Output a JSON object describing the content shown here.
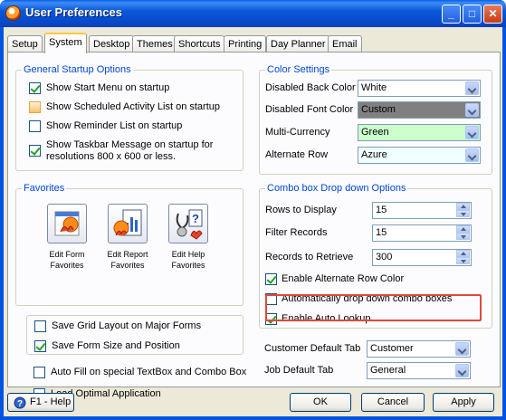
{
  "window": {
    "title": "User Preferences",
    "minimize": "_",
    "maximize": "□",
    "close": "✕"
  },
  "tabs": [
    "Setup",
    "System",
    "Desktop",
    "Themes",
    "Shortcuts",
    "Printing",
    "Day Planner",
    "Email"
  ],
  "active_tab": "System",
  "startup": {
    "title": "General Startup Options",
    "items": [
      {
        "label": "Show Start Menu on startup",
        "checked": true
      },
      {
        "label": "Show Scheduled Activity List on startup",
        "checked": false
      },
      {
        "label": "Show Reminder List on startup",
        "checked": false
      },
      {
        "label": "Show Taskbar Message on startup for",
        "label2": "resolutions 800 x 600 or less.",
        "checked": true
      }
    ]
  },
  "favorites": {
    "title": "Favorites",
    "buttons": [
      {
        "line1": "Edit Form",
        "line2": "Favorites",
        "icon": "form-favorites-icon"
      },
      {
        "line1": "Edit Report",
        "line2": "Favorites",
        "icon": "report-favorites-icon"
      },
      {
        "line1": "Edit Help",
        "line2": "Favorites",
        "icon": "help-favorites-icon"
      }
    ]
  },
  "misc": [
    {
      "label": "Save Grid Layout on Major Forms",
      "checked": false
    },
    {
      "label": "Save Form Size and Position",
      "checked": true
    },
    {
      "label": "Auto Fill on special TextBox and Combo Box",
      "checked": false
    },
    {
      "label": "Load Optimal Application",
      "checked": false
    }
  ],
  "colors": {
    "title": "Color Settings",
    "rows": [
      {
        "label": "Disabled Back Color",
        "value": "White",
        "bg": "#ffffff"
      },
      {
        "label": "Disabled Font Color",
        "value": "Custom",
        "bg": "#808080"
      },
      {
        "label": "Multi-Currency",
        "value": "Green",
        "bg": "#ccffcc"
      },
      {
        "label": "Alternate Row",
        "value": "Azure",
        "bg": "#f0ffff"
      }
    ]
  },
  "combo_opts": {
    "title": "Combo box Drop down Options",
    "rows_to_display_label": "Rows to Display",
    "rows_to_display": "15",
    "filter_records_label": "Filter Records",
    "filter_records": "15",
    "records_to_retrieve_label": "Records to Retrieve",
    "records_to_retrieve": "300",
    "checks": [
      {
        "label": "Enable Alternate Row Color",
        "checked": true
      },
      {
        "label": "Automatically drop down combo boxes",
        "checked": false
      },
      {
        "label": "Enable Auto Lookup",
        "checked": true
      }
    ]
  },
  "defaults": {
    "customer_tab_label": "Customer Default Tab",
    "customer_tab": "Customer",
    "job_tab_label": "Job Default Tab",
    "job_tab": "General"
  },
  "footer": {
    "help": "F1 - Help",
    "ok": "OK",
    "cancel": "Cancel",
    "apply": "Apply"
  },
  "highlight_color": "#e04a3a"
}
